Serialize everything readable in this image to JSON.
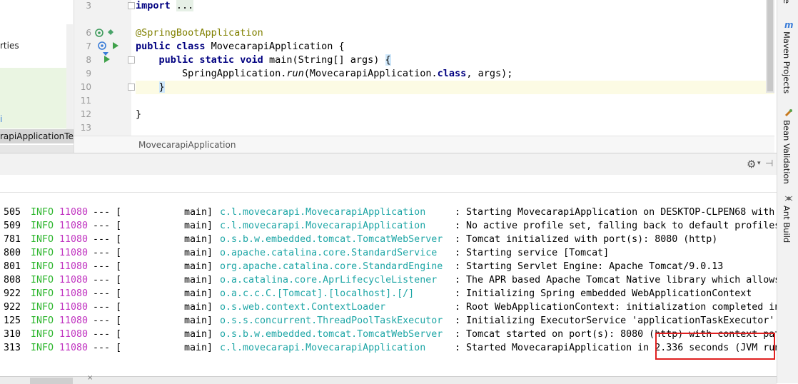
{
  "project_tree": {
    "partial_item": "rties",
    "partial_item_2": "i",
    "selected_item": "rapiApplicationTe"
  },
  "editor": {
    "gutter_line_numbers": [
      "3",
      "6",
      "7",
      "8",
      "9",
      "10",
      "11",
      "12",
      "13"
    ],
    "lines": {
      "l3_kw": "import",
      "l3_fold": "...",
      "l6_annotation": "@SpringBootApplication",
      "l7_kw": "public class",
      "l7_rest": " MovecarapiApplication {",
      "l8_kw": "public static void",
      "l8_rest": " main(String[] args) ",
      "l8_brace": "{",
      "l9_pre": "SpringApplication.",
      "l9_run": "run",
      "l9_mid": "(MovecarapiApplication.",
      "l9_kw": "class",
      "l9_post": ", args);",
      "l10_brace": "}",
      "l12_brace": "}"
    },
    "truncated_right": "F",
    "breadcrumb": "MovecarapiApplication"
  },
  "right_strip": {
    "maven_icon": "m",
    "maven_label": "Maven Projects",
    "bean_label": "Bean Validation",
    "ant_label": "Ant Build",
    "top_partial": "e"
  },
  "run_toolbar": {
    "gear_icon": "⚙",
    "gear_caret": "▾",
    "hide_icon": "⊣"
  },
  "console": {
    "separator": "--- [",
    "rows": [
      {
        "time": "505",
        "level": "INFO",
        "pid": "11080",
        "thread": "main]",
        "logger": "c.l.movecarapi.MovecarapiApplication",
        "message": ": Starting MovecarapiApplication on DESKTOP-CLPEN68 with P"
      },
      {
        "time": "509",
        "level": "INFO",
        "pid": "11080",
        "thread": "main]",
        "logger": "c.l.movecarapi.MovecarapiApplication",
        "message": ": No active profile set, falling back to default profiles:"
      },
      {
        "time": "781",
        "level": "INFO",
        "pid": "11080",
        "thread": "main]",
        "logger": "o.s.b.w.embedded.tomcat.TomcatWebServer",
        "message": ": Tomcat initialized with port(s): 8080 (http)"
      },
      {
        "time": "800",
        "level": "INFO",
        "pid": "11080",
        "thread": "main]",
        "logger": "o.apache.catalina.core.StandardService",
        "message": ": Starting service [Tomcat]"
      },
      {
        "time": "801",
        "level": "INFO",
        "pid": "11080",
        "thread": "main]",
        "logger": "org.apache.catalina.core.StandardEngine",
        "message": ": Starting Servlet Engine: Apache Tomcat/9.0.13"
      },
      {
        "time": "808",
        "level": "INFO",
        "pid": "11080",
        "thread": "main]",
        "logger": "o.a.catalina.core.AprLifecycleListener",
        "message": ": The APR based Apache Tomcat Native library which allows"
      },
      {
        "time": "922",
        "level": "INFO",
        "pid": "11080",
        "thread": "main]",
        "logger": "o.a.c.c.C.[Tomcat].[localhost].[/]",
        "message": ": Initializing Spring embedded WebApplicationContext"
      },
      {
        "time": "922",
        "level": "INFO",
        "pid": "11080",
        "thread": "main]",
        "logger": "o.s.web.context.ContextLoader",
        "message": ": Root WebApplicationContext: initialization completed in"
      },
      {
        "time": "125",
        "level": "INFO",
        "pid": "11080",
        "thread": "main]",
        "logger": "o.s.s.concurrent.ThreadPoolTaskExecutor",
        "message": ": Initializing ExecutorService 'applicationTaskExecutor'"
      },
      {
        "time": "310",
        "level": "INFO",
        "pid": "11080",
        "thread": "main]",
        "logger": "o.s.b.w.embedded.tomcat.TomcatWebServer",
        "message": ": Tomcat started on port(s): 8080 (http) with context path"
      },
      {
        "time": "313",
        "level": "INFO",
        "pid": "11080",
        "thread": "main]",
        "logger": "c.l.movecarapi.MovecarapiApplication",
        "message": ": Started MovecarapiApplication in 2.336 seconds (JVM runn"
      }
    ]
  },
  "colors": {
    "level_info": "#2bb52b",
    "pid": "#c033c0",
    "logger": "#1ea6a6",
    "highlight_box": "#e02020"
  },
  "status_bar": {
    "close_icon": "×"
  }
}
